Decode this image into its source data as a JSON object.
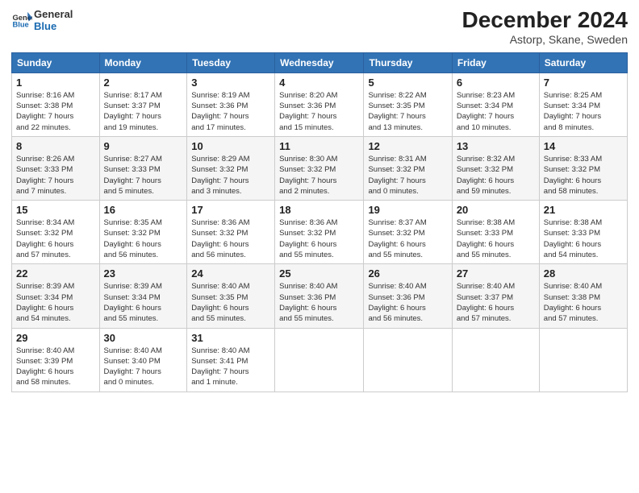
{
  "logo": {
    "line1": "General",
    "line2": "Blue"
  },
  "title": "December 2024",
  "subtitle": "Astorp, Skane, Sweden",
  "days_of_week": [
    "Sunday",
    "Monday",
    "Tuesday",
    "Wednesday",
    "Thursday",
    "Friday",
    "Saturday"
  ],
  "weeks": [
    [
      {
        "day": 1,
        "info": "Sunrise: 8:16 AM\nSunset: 3:38 PM\nDaylight: 7 hours\nand 22 minutes."
      },
      {
        "day": 2,
        "info": "Sunrise: 8:17 AM\nSunset: 3:37 PM\nDaylight: 7 hours\nand 19 minutes."
      },
      {
        "day": 3,
        "info": "Sunrise: 8:19 AM\nSunset: 3:36 PM\nDaylight: 7 hours\nand 17 minutes."
      },
      {
        "day": 4,
        "info": "Sunrise: 8:20 AM\nSunset: 3:36 PM\nDaylight: 7 hours\nand 15 minutes."
      },
      {
        "day": 5,
        "info": "Sunrise: 8:22 AM\nSunset: 3:35 PM\nDaylight: 7 hours\nand 13 minutes."
      },
      {
        "day": 6,
        "info": "Sunrise: 8:23 AM\nSunset: 3:34 PM\nDaylight: 7 hours\nand 10 minutes."
      },
      {
        "day": 7,
        "info": "Sunrise: 8:25 AM\nSunset: 3:34 PM\nDaylight: 7 hours\nand 8 minutes."
      }
    ],
    [
      {
        "day": 8,
        "info": "Sunrise: 8:26 AM\nSunset: 3:33 PM\nDaylight: 7 hours\nand 7 minutes."
      },
      {
        "day": 9,
        "info": "Sunrise: 8:27 AM\nSunset: 3:33 PM\nDaylight: 7 hours\nand 5 minutes."
      },
      {
        "day": 10,
        "info": "Sunrise: 8:29 AM\nSunset: 3:32 PM\nDaylight: 7 hours\nand 3 minutes."
      },
      {
        "day": 11,
        "info": "Sunrise: 8:30 AM\nSunset: 3:32 PM\nDaylight: 7 hours\nand 2 minutes."
      },
      {
        "day": 12,
        "info": "Sunrise: 8:31 AM\nSunset: 3:32 PM\nDaylight: 7 hours\nand 0 minutes."
      },
      {
        "day": 13,
        "info": "Sunrise: 8:32 AM\nSunset: 3:32 PM\nDaylight: 6 hours\nand 59 minutes."
      },
      {
        "day": 14,
        "info": "Sunrise: 8:33 AM\nSunset: 3:32 PM\nDaylight: 6 hours\nand 58 minutes."
      }
    ],
    [
      {
        "day": 15,
        "info": "Sunrise: 8:34 AM\nSunset: 3:32 PM\nDaylight: 6 hours\nand 57 minutes."
      },
      {
        "day": 16,
        "info": "Sunrise: 8:35 AM\nSunset: 3:32 PM\nDaylight: 6 hours\nand 56 minutes."
      },
      {
        "day": 17,
        "info": "Sunrise: 8:36 AM\nSunset: 3:32 PM\nDaylight: 6 hours\nand 56 minutes."
      },
      {
        "day": 18,
        "info": "Sunrise: 8:36 AM\nSunset: 3:32 PM\nDaylight: 6 hours\nand 55 minutes."
      },
      {
        "day": 19,
        "info": "Sunrise: 8:37 AM\nSunset: 3:32 PM\nDaylight: 6 hours\nand 55 minutes."
      },
      {
        "day": 20,
        "info": "Sunrise: 8:38 AM\nSunset: 3:33 PM\nDaylight: 6 hours\nand 55 minutes."
      },
      {
        "day": 21,
        "info": "Sunrise: 8:38 AM\nSunset: 3:33 PM\nDaylight: 6 hours\nand 54 minutes."
      }
    ],
    [
      {
        "day": 22,
        "info": "Sunrise: 8:39 AM\nSunset: 3:34 PM\nDaylight: 6 hours\nand 54 minutes."
      },
      {
        "day": 23,
        "info": "Sunrise: 8:39 AM\nSunset: 3:34 PM\nDaylight: 6 hours\nand 55 minutes."
      },
      {
        "day": 24,
        "info": "Sunrise: 8:40 AM\nSunset: 3:35 PM\nDaylight: 6 hours\nand 55 minutes."
      },
      {
        "day": 25,
        "info": "Sunrise: 8:40 AM\nSunset: 3:36 PM\nDaylight: 6 hours\nand 55 minutes."
      },
      {
        "day": 26,
        "info": "Sunrise: 8:40 AM\nSunset: 3:36 PM\nDaylight: 6 hours\nand 56 minutes."
      },
      {
        "day": 27,
        "info": "Sunrise: 8:40 AM\nSunset: 3:37 PM\nDaylight: 6 hours\nand 57 minutes."
      },
      {
        "day": 28,
        "info": "Sunrise: 8:40 AM\nSunset: 3:38 PM\nDaylight: 6 hours\nand 57 minutes."
      }
    ],
    [
      {
        "day": 29,
        "info": "Sunrise: 8:40 AM\nSunset: 3:39 PM\nDaylight: 6 hours\nand 58 minutes."
      },
      {
        "day": 30,
        "info": "Sunrise: 8:40 AM\nSunset: 3:40 PM\nDaylight: 7 hours\nand 0 minutes."
      },
      {
        "day": 31,
        "info": "Sunrise: 8:40 AM\nSunset: 3:41 PM\nDaylight: 7 hours\nand 1 minute."
      },
      null,
      null,
      null,
      null
    ]
  ]
}
